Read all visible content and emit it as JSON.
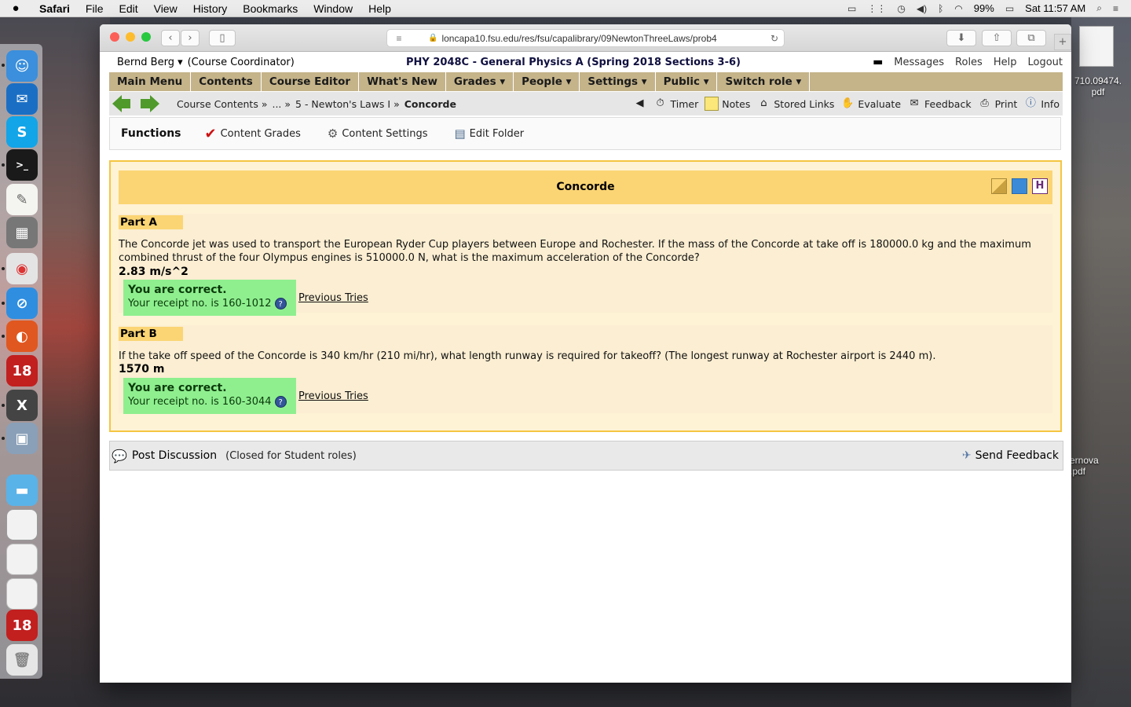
{
  "menubar": {
    "apple": "",
    "items": [
      "Safari",
      "File",
      "Edit",
      "View",
      "History",
      "Bookmarks",
      "Window",
      "Help"
    ],
    "battery": "99%",
    "clock": "Sat 11:57 AM"
  },
  "safari": {
    "url": "loncapa10.fsu.edu/res/fsu/capalibrary/09NewtonThreeLaws/prob4"
  },
  "lc_header": {
    "user": "Bernd Berg ▾",
    "role": "(Course Coordinator)",
    "course": "PHY 2048C - General Physics A (Spring 2018 Sections 3-6)",
    "links": [
      "Messages",
      "Roles",
      "Help",
      "Logout"
    ]
  },
  "mainnav": [
    "Main Menu",
    "Contents",
    "Course Editor",
    "What's New",
    "Grades ▾",
    "People ▾",
    "Settings ▾",
    "Public ▾",
    "Switch role ▾"
  ],
  "breadcrumbs": {
    "items": [
      "Course Contents »",
      "... »",
      "5 - Newton's Laws I »"
    ],
    "current": "Concorde"
  },
  "tools": [
    "Timer",
    "Notes",
    "Stored Links",
    "Evaluate",
    "Feedback",
    "Print",
    "Info"
  ],
  "functions": {
    "title": "Functions",
    "items": [
      "Content Grades",
      "Content Settings",
      "Edit Folder"
    ]
  },
  "problem": {
    "title": "Concorde",
    "parts": [
      {
        "label": "Part A",
        "question": "The Concorde jet was used to transport the European Ryder Cup players between Europe and Rochester. If the mass of the Concorde at take off is 180000.0 kg and the maximum combined thrust of the four Olympus engines is 510000.0 N, what is the maximum acceleration of the Concorde?",
        "answer": "2.83 m/s^2",
        "status": "You are correct.",
        "receipt": "Your receipt no. is 160-1012",
        "previous": "Previous Tries"
      },
      {
        "label": "Part B",
        "question": "If the take off speed of the Concorde is 340 km/hr (210 mi/hr), what length runway is required for takeoff? (The longest runway at Rochester airport is 2440 m).",
        "answer": "1570 m",
        "status": "You are correct.",
        "receipt": "Your receipt no. is 160-3044",
        "previous": "Previous Tries"
      }
    ]
  },
  "discussion": {
    "post": "Post Discussion",
    "note": "(Closed for Student roles)",
    "send": "Send Feedback"
  },
  "desktop": {
    "file1": "710.09474.\npdf",
    "file2": "ernova\n.pdf"
  }
}
